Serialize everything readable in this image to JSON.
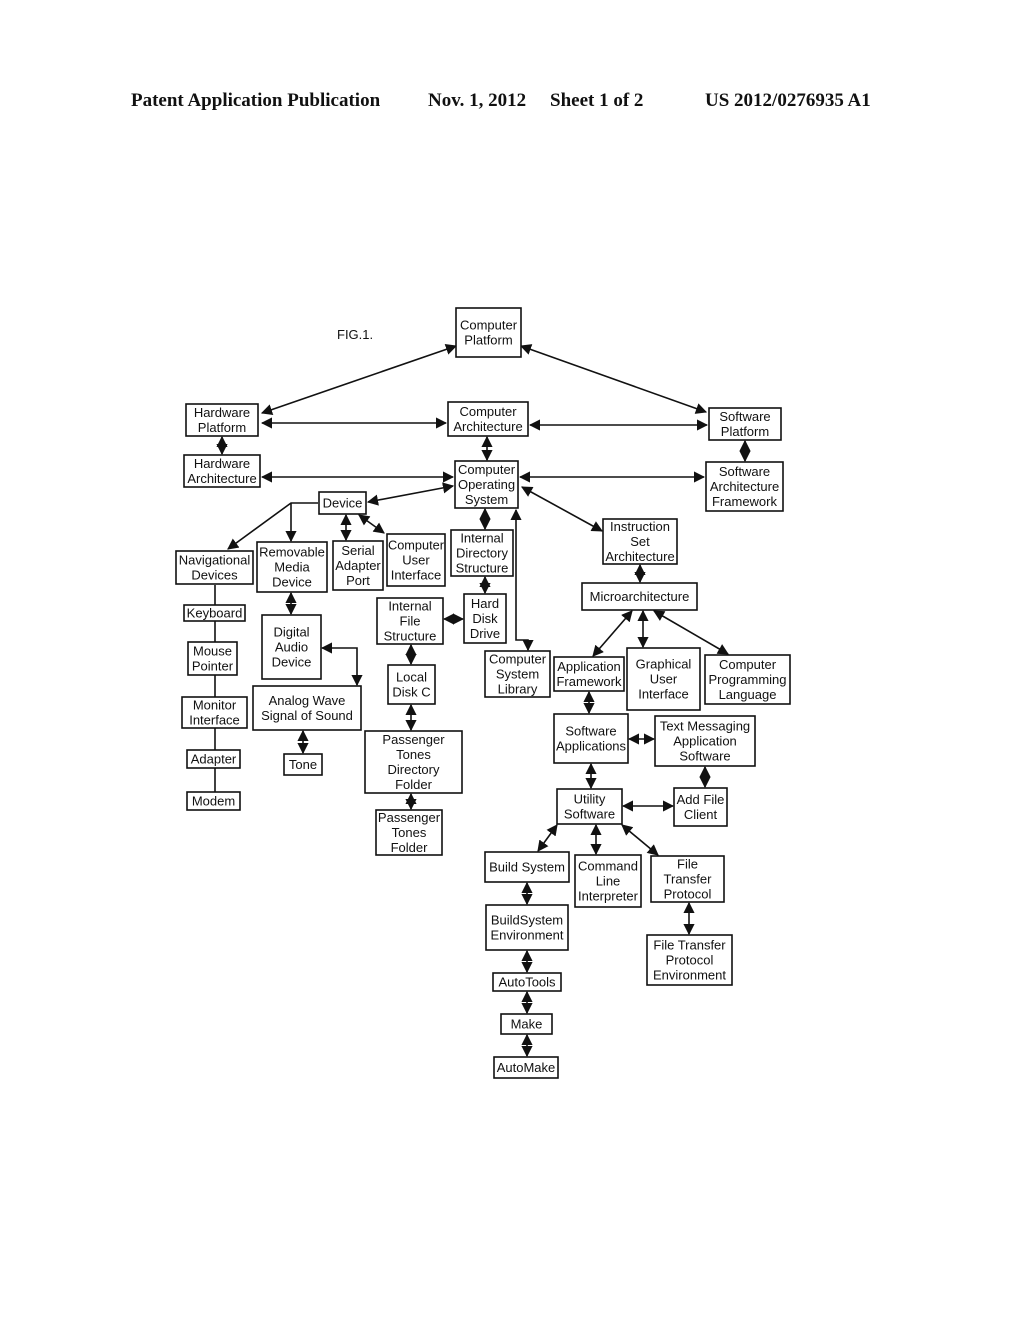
{
  "header": {
    "publication": "Patent Application Publication",
    "date": "Nov. 1, 2012",
    "sheet": "Sheet 1 of 2",
    "number": "US 2012/0276935 A1"
  },
  "figure": {
    "label": "FIG.1.",
    "nodes": {
      "computer_platform": [
        "Computer",
        "Platform"
      ],
      "hardware_platform": [
        "Hardware",
        "Platform"
      ],
      "computer_architecture": [
        "Computer",
        "Architecture"
      ],
      "software_platform": [
        "Software",
        "Platform"
      ],
      "hardware_architecture": [
        "Hardware",
        "Architecture"
      ],
      "computer_operating_system": [
        "Computer",
        "Operating",
        "System"
      ],
      "software_architecture_framework": [
        "Software",
        "Architecture",
        "Framework"
      ],
      "device": [
        "Device"
      ],
      "navigational_devices": [
        "Navigational",
        "Devices"
      ],
      "removable_media_device": [
        "Removable",
        "Media",
        "Device"
      ],
      "serial_adapter_port": [
        "Serial",
        "Adapter",
        "Port"
      ],
      "computer_user_interface": [
        "Computer",
        "User",
        "Interface"
      ],
      "internal_directory_structure": [
        "Internal",
        "Directory",
        "Structure"
      ],
      "instruction_set_architecture": [
        "Instruction",
        "Set",
        "Architecture"
      ],
      "keyboard": [
        "Keyboard"
      ],
      "mouse_pointer": [
        "Mouse",
        "Pointer"
      ],
      "monitor_interface": [
        "Monitor",
        "Interface"
      ],
      "adapter": [
        "Adapter"
      ],
      "modem": [
        "Modem"
      ],
      "digital_audio_device": [
        "Digital",
        "Audio",
        "Device"
      ],
      "analog_wave_signal": [
        "Analog Wave",
        "Signal of Sound"
      ],
      "tone": [
        "Tone"
      ],
      "internal_file_structure": [
        "Internal",
        "File",
        "Structure"
      ],
      "hard_disk_drive": [
        "Hard",
        "Disk",
        "Drive"
      ],
      "local_disk_c": [
        "Local",
        "Disk C"
      ],
      "passenger_tones_directory_folder": [
        "Passenger",
        "Tones",
        "Directory",
        "Folder"
      ],
      "passenger_tones_folder": [
        "Passenger",
        "Tones",
        "Folder"
      ],
      "microarchitecture": [
        "Microarchitecture"
      ],
      "computer_system_library": [
        "Computer",
        "System",
        "Library"
      ],
      "application_framework": [
        "Application",
        "Framework"
      ],
      "graphical_user_interface": [
        "Graphical",
        "User",
        "Interface"
      ],
      "computer_programming_language": [
        "Computer",
        "Programming",
        "Language"
      ],
      "software_applications": [
        "Software",
        "Applications"
      ],
      "text_messaging_application_software": [
        "Text Messaging",
        "Application",
        "Software"
      ],
      "utility_software": [
        "Utility",
        "Software"
      ],
      "add_file_client": [
        "Add File",
        "Client"
      ],
      "build_system": [
        "Build System"
      ],
      "command_line_interpreter": [
        "Command",
        "Line",
        "Interpreter"
      ],
      "file_transfer_protocol": [
        "File",
        "Transfer",
        "Protocol"
      ],
      "buildsystem_environment": [
        "BuildSystem",
        "Environment"
      ],
      "file_transfer_protocol_environment": [
        "File Transfer",
        "Protocol",
        "Environment"
      ],
      "autotools": [
        "AutoTools"
      ],
      "make": [
        "Make"
      ],
      "automake": [
        "AutoMake"
      ]
    }
  }
}
